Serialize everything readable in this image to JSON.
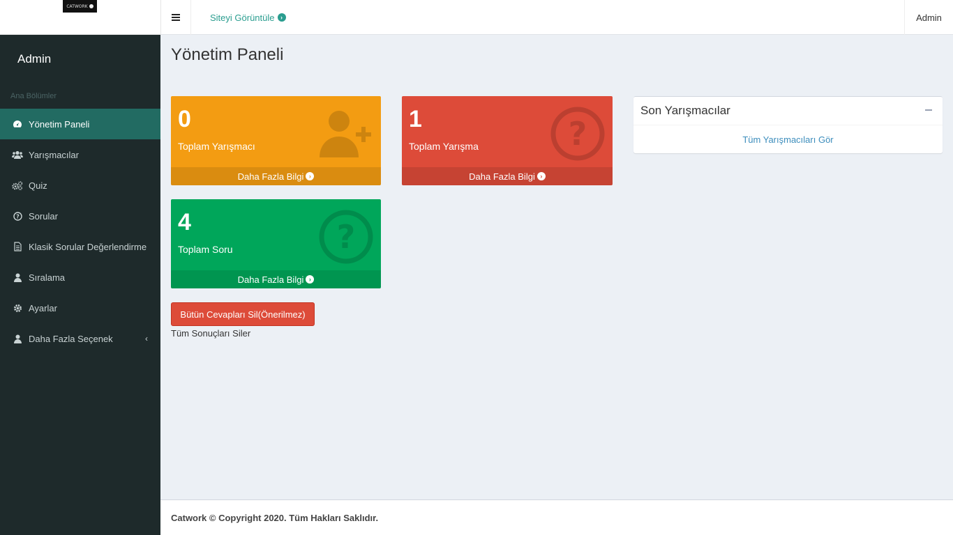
{
  "logo": {
    "text": "CATWORK"
  },
  "topbar": {
    "view_site": "Siteyi Görüntüle",
    "user": "Admin"
  },
  "sidebar": {
    "user_name": "Admin",
    "section_header": "Ana Bölümler",
    "items": [
      {
        "label": "Yönetim Paneli",
        "icon": "dashboard-icon",
        "active": true
      },
      {
        "label": "Yarışmacılar",
        "icon": "users-icon"
      },
      {
        "label": "Quiz",
        "icon": "cogs-icon"
      },
      {
        "label": "Sorular",
        "icon": "question-circle-icon"
      },
      {
        "label": "Klasik Sorular Değerlendirme",
        "icon": "file-icon"
      },
      {
        "label": "Sıralama",
        "icon": "user-icon"
      },
      {
        "label": "Ayarlar",
        "icon": "gear-icon"
      },
      {
        "label": "Daha Fazla Seçenek",
        "icon": "user-icon"
      }
    ]
  },
  "main": {
    "title": "Yönetim Paneli",
    "stats": [
      {
        "value": "0",
        "label": "Toplam Yarışmacı",
        "more": "Daha Fazla Bilgi",
        "color": "#f39c12",
        "icon": "user-plus-icon"
      },
      {
        "value": "1",
        "label": "Toplam Yarışma",
        "more": "Daha Fazla Bilgi",
        "color": "#dd4b39",
        "icon": "question-circle-icon"
      },
      {
        "value": "4",
        "label": "Toplam Soru",
        "more": "Daha Fazla Bilgi",
        "color": "#00a65a",
        "icon": "question-circle-icon"
      }
    ],
    "danger_button": "Bütün Cevapları Sil(Önerilmez)",
    "danger_note": "Tüm Sonuçları Siler",
    "recent_box": {
      "title": "Son Yarışmacılar",
      "link": "Tüm Yarışmacıları Gör"
    }
  },
  "footer": {
    "text": "Catwork © Copyright 2020. Tüm Hakları Saklıdır."
  }
}
